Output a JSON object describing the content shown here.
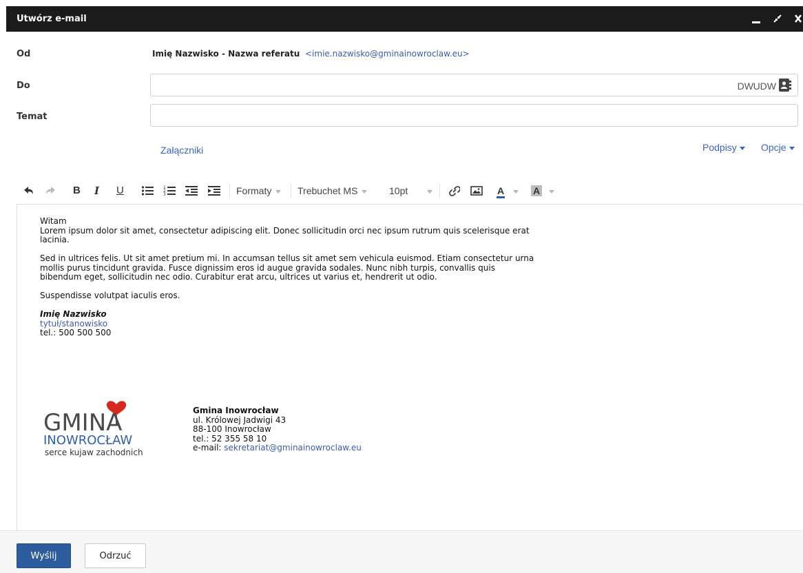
{
  "window": {
    "title": "Utwórz e-mail"
  },
  "from": {
    "label": "Od",
    "name": "Imię Nazwisko - Nazwa referatu",
    "email": "<imie.nazwisko@gminainowroclaw.eu>"
  },
  "to": {
    "label": "Do",
    "value": "",
    "cc_label": "DW",
    "bcc_label": "UDW"
  },
  "subject": {
    "label": "Temat",
    "value": ""
  },
  "attachments_label": "Załączniki",
  "signatures_label": "Podpisy",
  "options_label": "Opcje",
  "toolbar": {
    "formats_label": "Formaty",
    "font_family": "Trebuchet MS",
    "font_size": "10pt"
  },
  "body": {
    "greeting": "Witam",
    "paragraph1": "Lorem ipsum dolor sit amet, consectetur adipiscing elit. Donec sollicitudin orci nec ipsum rutrum quis scelerisque erat lacinia.",
    "paragraph2": "Sed in ultrices felis. Ut sit amet pretium mi. In accumsan tellus sit amet sem vehicula euismod. Etiam consectetur urna mollis purus tincidunt gravida. Fusce dignissim eros id augue gravida sodales. Nunc nibh turpis, convallis quis bibendum eget, sollicitudin nec odio. Curabitur erat arcu, ultrices ut varius et, hendrerit ut odio.",
    "paragraph3": "Suspendisse volutpat iaculis eros.",
    "signature": {
      "name": "Imię Nazwisko",
      "role": "tytuł/stanowisko",
      "phone": "tel.: 500 500 500"
    },
    "logo": {
      "line1": "GMINA",
      "line2": "INOWROCŁAW",
      "tagline": "serce kujaw zachodnich"
    },
    "org": {
      "name": "Gmina Inowrocław",
      "street": "ul. Królowej Jadwigi 43",
      "city": "88-100 Inowrocław",
      "phone": "tel.: 52 355 58 10",
      "email_prefix": "e-mail: ",
      "email": "sekretariat@gminainowroclaw.eu"
    }
  },
  "footer": {
    "send_label": "Wyślij",
    "discard_label": "Odrzuć"
  },
  "colors": {
    "titlebar": "#1b1b1b",
    "link": "#3b64c8",
    "primary_button": "#2d5d9f",
    "logo_heart": "#d42a1f"
  }
}
